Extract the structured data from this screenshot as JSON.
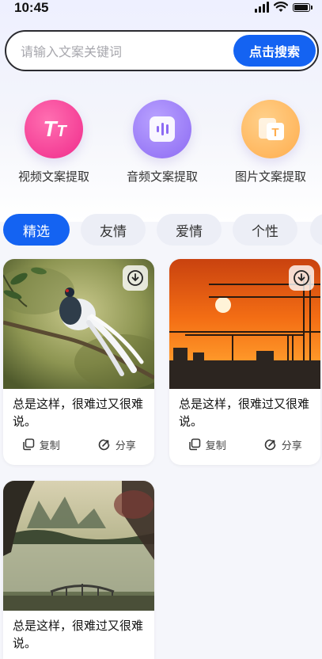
{
  "status": {
    "time": "10:45"
  },
  "search": {
    "placeholder": "请输入文案关键词",
    "button_label": "点击搜索"
  },
  "tools": [
    {
      "label": "视频文案提取",
      "icon": "video-text-icon",
      "color": "#f02b8b"
    },
    {
      "label": "音频文案提取",
      "icon": "audio-text-icon",
      "color": "#8c6af3"
    },
    {
      "label": "图片文案提取",
      "icon": "image-text-icon",
      "color": "#ffad4d"
    }
  ],
  "tabs": [
    {
      "label": "精选",
      "active": true
    },
    {
      "label": "友情"
    },
    {
      "label": "爱情"
    },
    {
      "label": "个性"
    }
  ],
  "cards": [
    {
      "text": "总是这样，很难过又很难说。",
      "copy_label": "复制",
      "share_label": "分享",
      "image": "pheasant-on-branch"
    },
    {
      "text": "总是这样，很难过又很难说。",
      "copy_label": "复制",
      "share_label": "分享",
      "image": "sunset-cranes"
    },
    {
      "text": "总是这样，很难过又很难说。",
      "image": "lake-bridge-painting"
    }
  ],
  "colors": {
    "accent": "#1463f2",
    "tab_bg": "#eceef6"
  }
}
